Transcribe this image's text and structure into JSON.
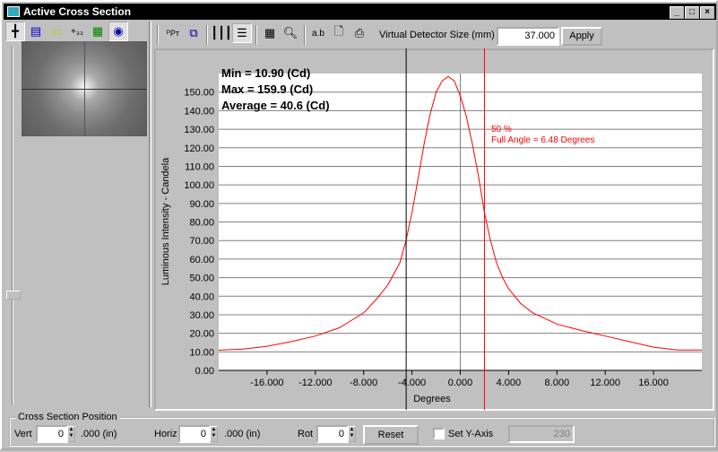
{
  "window": {
    "title": "Active Cross Section"
  },
  "toolbar": {
    "detector_label": "Virtual Detector Size (mm)",
    "detector_value": "37.000",
    "apply_label": "Apply"
  },
  "stats": {
    "min": "Min = 10.90 (Cd)",
    "max": "Max = 159.9 (Cd)",
    "avg": "Average = 40.6 (Cd)"
  },
  "annotation": {
    "pct": "50 %",
    "full_angle": "Full Angle = 6.48 Degrees"
  },
  "colors": {
    "curve": "#ff0000",
    "half_line": "#ff0000"
  },
  "chart_data": {
    "type": "line",
    "xlabel": "Degrees",
    "ylabel": "Luminous Intensity - Candela",
    "xlim": [
      -20,
      20
    ],
    "ylim": [
      0,
      160
    ],
    "xticks": [
      "-16.000",
      "-12.000",
      "-8.000",
      "-4.000",
      "0.000",
      "4.000",
      "8.000",
      "12.000",
      "16.000"
    ],
    "xtick_values": [
      -16,
      -12,
      -8,
      -4,
      0,
      4,
      8,
      12,
      16
    ],
    "yticks": [
      "0.00",
      "10.00",
      "20.00",
      "30.00",
      "40.00",
      "50.00",
      "60.00",
      "70.00",
      "80.00",
      "90.00",
      "100.00",
      "110.00",
      "120.00",
      "130.00",
      "140.00",
      "150.00"
    ],
    "half_max_left": -4.48,
    "half_max_right": 2.0,
    "series": [
      {
        "name": "Cross Section",
        "x": [
          -20,
          -18,
          -16,
          -14,
          -12,
          -10,
          -8,
          -7,
          -6,
          -5,
          -4.5,
          -4,
          -3.5,
          -3,
          -2.5,
          -2,
          -1.5,
          -1,
          -0.5,
          0,
          0.5,
          1,
          1.5,
          2,
          2.5,
          3,
          3.5,
          4,
          5,
          6,
          8,
          10,
          12,
          14,
          16,
          18,
          20
        ],
        "y": [
          10.9,
          11.5,
          13,
          15.5,
          18.5,
          23,
          31,
          38,
          46,
          58,
          70,
          85,
          103,
          122,
          138,
          150,
          156,
          158.5,
          156,
          148,
          137,
          122,
          105,
          85,
          70,
          58,
          50,
          44,
          36,
          31,
          25,
          21.5,
          18.5,
          15.5,
          12.5,
          11,
          11
        ]
      }
    ]
  },
  "bottom": {
    "group_label": "Cross Section Position",
    "vert_label": "Vert",
    "vert_value": "0",
    "vert_unit": ".000 (in)",
    "horiz_label": "Horiz",
    "horiz_value": "0",
    "horiz_unit": ".000 (in)",
    "rot_label": "Rot",
    "rot_value": "0",
    "reset_label": "Reset",
    "sety_label": "Set Y-Axis",
    "sety_value": "230"
  }
}
